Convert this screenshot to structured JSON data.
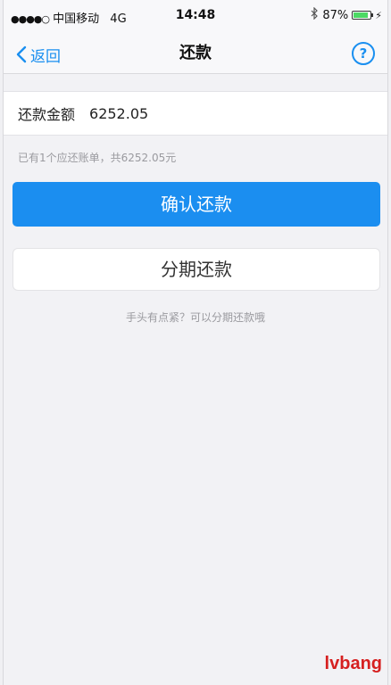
{
  "status_bar": {
    "carrier": "中国移动",
    "network": "4G",
    "time": "14:48",
    "battery": "87%",
    "battery_level": 0.87
  },
  "nav": {
    "back_label": "返回",
    "title": "还款",
    "help_label": "?"
  },
  "repayment": {
    "amount_label": "还款金额",
    "amount_value": "6252.05",
    "bill_hint": "已有1个应还账单，共6252.05元"
  },
  "actions": {
    "confirm_label": "确认还款",
    "installment_label": "分期还款",
    "installment_tip": "手头有点紧？可以分期还款哦"
  },
  "watermark": "lvbang",
  "colors": {
    "accent": "#1b8ef0",
    "watermark": "#d62020"
  }
}
